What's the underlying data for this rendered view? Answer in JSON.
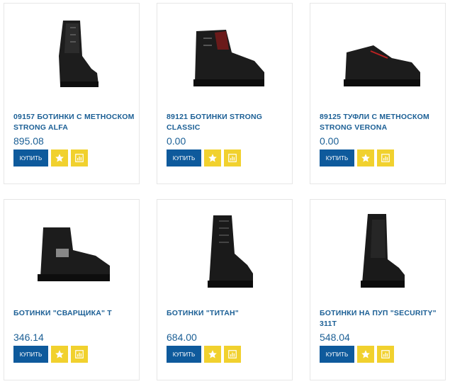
{
  "products": [
    {
      "title": "09157 Ботинки с метноском STRONG ALFA",
      "price": "895.08",
      "buy_label": "КУПИТЬ"
    },
    {
      "title": "89121 БОТИНКИ STRONG CLASSIC",
      "price": "0.00",
      "buy_label": "КУПИТЬ"
    },
    {
      "title": "89125 ТУФЛИ С МЕТНОСКОМ STRONG VERONA",
      "price": "0.00",
      "buy_label": "КУПИТЬ"
    },
    {
      "title": "Ботинки \"Сварщика\" Т",
      "price": "346.14",
      "buy_label": "КУПИТЬ"
    },
    {
      "title": "Ботинки \"Титан\"",
      "price": "684.00",
      "buy_label": "КУПИТЬ"
    },
    {
      "title": "Ботинки на ПУП \"SECURITY\" 311Т",
      "price": "548.04",
      "buy_label": "КУПИТЬ"
    }
  ],
  "icons": {
    "favorite": "star-icon",
    "compare": "bar-chart-icon"
  },
  "colors": {
    "title": "#1b5f95",
    "buy_button": "#0e5a9c",
    "icon_button": "#f1d12e"
  }
}
